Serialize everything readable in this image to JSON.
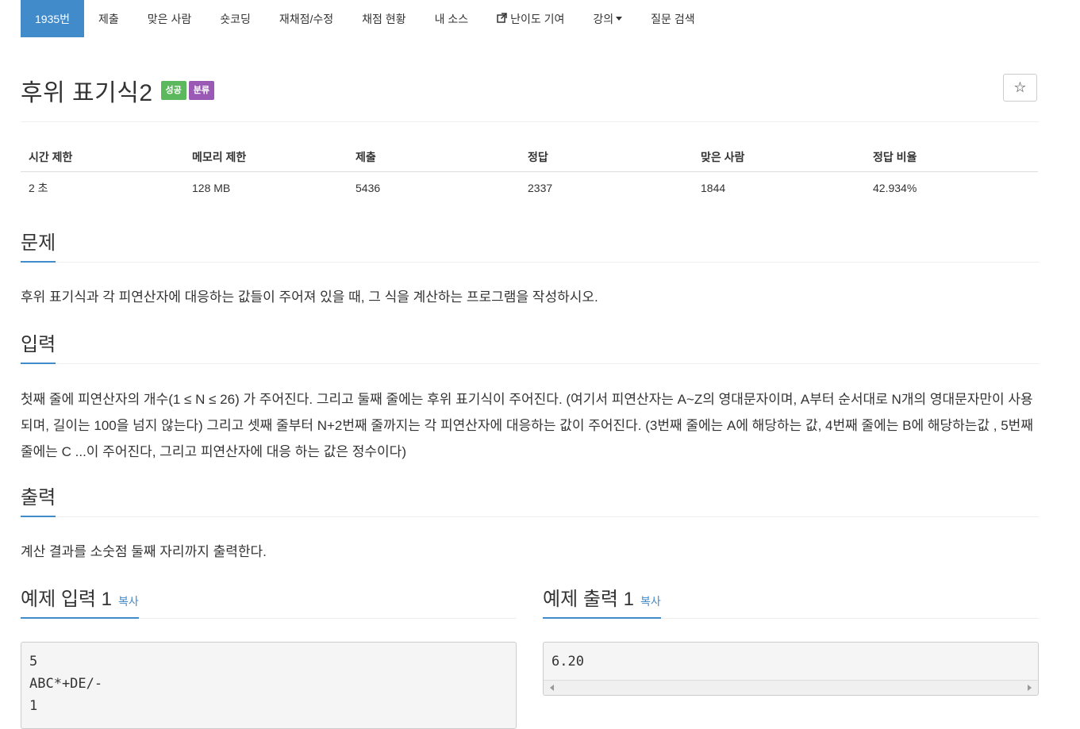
{
  "nav": {
    "tabs": [
      {
        "label": "1935번"
      },
      {
        "label": "제출"
      },
      {
        "label": "맞은 사람"
      },
      {
        "label": "숏코딩"
      },
      {
        "label": "재채점/수정"
      },
      {
        "label": "채점 현황"
      },
      {
        "label": "내 소스"
      },
      {
        "label": "난이도 기여",
        "icon": "external-link-icon"
      },
      {
        "label": "강의",
        "icon": "caret-down-icon"
      },
      {
        "label": "질문 검색"
      }
    ]
  },
  "problem": {
    "title": "후위 표기식2",
    "badges": {
      "success": "성공",
      "classification": "분류"
    },
    "star": "☆"
  },
  "info_table": {
    "headers": [
      "시간 제한",
      "메모리 제한",
      "제출",
      "정답",
      "맞은 사람",
      "정답 비율"
    ],
    "values": [
      "2 초",
      "128 MB",
      "5436",
      "2337",
      "1844",
      "42.934%"
    ]
  },
  "sections": {
    "problem": {
      "heading": "문제",
      "text": "후위 표기식과 각 피연산자에 대응하는 값들이 주어져 있을 때, 그 식을 계산하는 프로그램을 작성하시오."
    },
    "input": {
      "heading": "입력",
      "text": "첫째 줄에 피연산자의 개수(1 ≤ N ≤ 26) 가 주어진다. 그리고 둘째 줄에는 후위 표기식이 주어진다. (여기서 피연산자는 A~Z의 영대문자이며, A부터 순서대로 N개의 영대문자만이 사용되며, 길이는 100을 넘지 않는다) 그리고 셋째 줄부터 N+2번째 줄까지는 각 피연산자에 대응하는 값이 주어진다. (3번째 줄에는 A에 해당하는 값, 4번째 줄에는 B에 해당하는값 , 5번째 줄에는 C ...이 주어진다, 그리고 피연산자에 대응 하는 값은 정수이다)"
    },
    "output": {
      "heading": "출력",
      "text": "계산 결과를 소숫점 둘째 자리까지 출력한다."
    }
  },
  "samples": {
    "input": {
      "heading": "예제 입력 1",
      "copy": "복사",
      "content": "5\nABC*+DE/-\n1"
    },
    "output": {
      "heading": "예제 출력 1",
      "copy": "복사",
      "content": "6.20"
    }
  },
  "colors": {
    "accent": "#428bca",
    "success": "#5cb85c",
    "classification": "#9b59b6"
  }
}
